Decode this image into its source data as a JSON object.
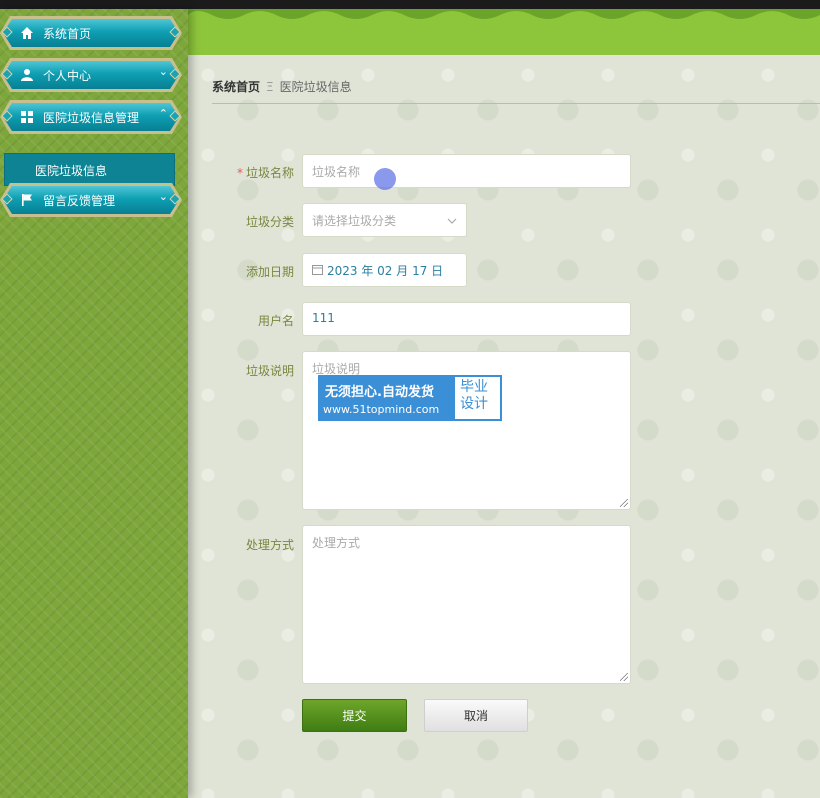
{
  "sidebar": {
    "items": [
      {
        "label": "系统首页",
        "icon": "home-icon"
      },
      {
        "label": "个人中心",
        "icon": "user-icon",
        "arrow": "⌄"
      },
      {
        "label": "医院垃圾信息管理",
        "icon": "grid-icon",
        "arrow": "⌃",
        "children": [
          {
            "label": "医院垃圾信息"
          }
        ]
      },
      {
        "label": "留言反馈管理",
        "icon": "flag-icon",
        "arrow": "⌄"
      }
    ]
  },
  "breadcrumb": {
    "home": "系统首页",
    "separator": "Ξ",
    "current": "医院垃圾信息"
  },
  "form": {
    "name": {
      "label": "垃圾名称",
      "required_mark": "*",
      "placeholder": "垃圾名称"
    },
    "category": {
      "label": "垃圾分类",
      "placeholder": "请选择垃圾分类"
    },
    "date": {
      "label": "添加日期",
      "value": "2023 年 02 月 17 日"
    },
    "username": {
      "label": "用户名",
      "value": "111"
    },
    "description": {
      "label": "垃圾说明",
      "placeholder": "垃圾说明"
    },
    "handling": {
      "label": "处理方式",
      "placeholder": "处理方式"
    },
    "submit_label": "提交",
    "cancel_label": "取消"
  },
  "watermark": {
    "line1": "无须担心.自动发货",
    "line2": "www.51topmind.com",
    "right": "毕业设计"
  },
  "colors": {
    "accent": "#0e9fb3",
    "header": "#8dc63a",
    "sidebar": "#7da63b",
    "submit": "#4f8f1c"
  }
}
